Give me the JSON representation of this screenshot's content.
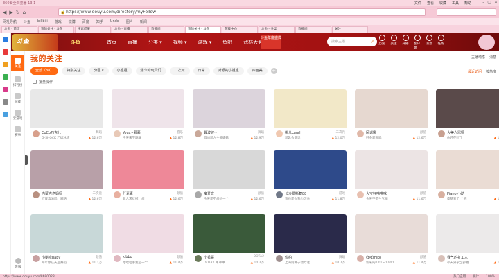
{
  "browser": {
    "title": "360安全浏览器 13.1",
    "menus": [
      "文件",
      "查看",
      "收藏",
      "工具",
      "帮助"
    ],
    "url_scheme": "https://",
    "url": "www.douyu.com/directory/myFollow",
    "bookmarks": [
      "网址导航",
      "斗鱼",
      "bilibili",
      "游戏",
      "微博",
      "百度",
      "知乎",
      "Undo",
      "图片",
      "新闻"
    ],
    "tabs": [
      "斗鱼 - 首页",
      "我的关注 - 斗鱼",
      "搜索结果",
      "斗鱼 - 直播",
      "直播间",
      "我的关注 - 斗鱼",
      "游戏中心",
      "斗鱼 - 分类",
      "直播间",
      "关注"
    ],
    "active_tab": 5,
    "status_url": "https://www.douyu.com/8690028",
    "status_right": [
      "热门应用",
      "统计",
      "100%"
    ]
  },
  "site": {
    "logo_text": "斗鱼",
    "logo_sub": "斗鱼",
    "nav": [
      "首页",
      "直播",
      "分类 ▾",
      "视频 ▾",
      "游戏 ▾",
      "鱼吧",
      "武林大会"
    ],
    "promo": "斗鱼年度盛典",
    "search_placeholder": "搜索主播",
    "header_icons": [
      "历史",
      "关注",
      "开播",
      "客户端",
      "消息",
      "任务"
    ],
    "sidebar": [
      {
        "label": "关注",
        "active": true,
        "color": "#ff6a13"
      },
      {
        "label": "排行榜",
        "active": false,
        "color": "#c9c9c9"
      },
      {
        "label": "游戏",
        "active": false,
        "color": "#c9c9c9"
      },
      {
        "label": "云游戏",
        "active": false,
        "color": "#c9c9c9"
      },
      {
        "label": "赛事",
        "active": false,
        "color": "#c9c9c9"
      }
    ],
    "sidebar_bottom": "客服"
  },
  "main": {
    "title": "我的关注",
    "right_options": [
      "主播动态",
      "消息"
    ],
    "filters": [
      "全部（88）",
      "特别关注",
      "分区 ▾",
      "小姐姐",
      "爆少的玩具们",
      "二次元",
      "日常",
      "对眼的小姐姐",
      "四画美"
    ],
    "active_filter": 0,
    "sort_options": [
      "最近访问",
      "按热度"
    ],
    "batch_label": "批量操作"
  },
  "cards": [
    {
      "name": "CoCo巧克儿",
      "sub": "G-SHOCK 乙级冰冻",
      "cat": "舞蹈",
      "heat": "12.6万",
      "thumb": "#e8e8e8",
      "ava": "#d8a08c"
    },
    {
      "name": "Youx~慕慕",
      "sub": "今天来学跳舞",
      "cat": "音乐",
      "heat": "12.8万",
      "thumb": "#efe4ea",
      "ava": "#e8c9b7"
    },
    {
      "name": "翼波波~",
      "sub": "四川新人主播蟾蜍",
      "cat": "舞蹈",
      "heat": "12.9万",
      "thumb": "#dcd4dc",
      "ava": "#c9a899"
    },
    {
      "name": "桃儿Laurl",
      "sub": "新歌会说话",
      "cat": "二次元",
      "heat": "12.0万",
      "thumb": "#f2e8c8",
      "ava": "#f0c8b0"
    },
    {
      "name": "民谣娜",
      "sub": "好多新歌唱",
      "cat": "颜值",
      "heat": "12.6万",
      "thumb": "#e6d8d0",
      "ava": "#e0b8a8"
    },
    {
      "name": "大美人罂姬",
      "sub": "你还在吗了",
      "cat": "颜值",
      "heat": "12.6万",
      "thumb": "#5a4a4a",
      "ava": "#c8a090"
    },
    {
      "name": "内蒙古老妈妈",
      "sub": "红双喜清唱，哪路",
      "cat": "二次元",
      "heat": "12.6万",
      "thumb": "#b8a0a8",
      "ava": "#b89080"
    },
    {
      "name": "阡素素",
      "sub": "新人求抚摸，想上",
      "cat": "颜值",
      "heat": "12.6万",
      "thumb": "#ee8898",
      "ava": "#e8b0a0"
    },
    {
      "name": "魔爱玫",
      "sub": "今天是不想想一个",
      "cat": "颜值",
      "heat": "12.6万",
      "thumb": "#d8d8d8",
      "ava": "#a8a8a8"
    },
    {
      "name": "长沙爱撕藏88",
      "sub": "我也是你我也可季",
      "cat": "游戏",
      "heat": "11.8万",
      "thumb": "#2e4a8a",
      "ava": "#707888"
    },
    {
      "name": "大宝好喵喵咪",
      "sub": "今天不是生气潮",
      "cat": "颜值",
      "heat": "11.6万",
      "thumb": "#ece4e4",
      "ava": "#e8c0b0"
    },
    {
      "name": "Pianoi小助",
      "sub": "电脑对了 个吧",
      "cat": "颜值",
      "heat": "12.0万",
      "thumb": "#eadcd4",
      "ava": "#d8b0a0"
    },
    {
      "name": "小秘密baby",
      "sub": "每年你在天后舞蹈",
      "cat": "颜值",
      "heat": "11.1万",
      "thumb": "#c8d8d8",
      "ava": "#c8a0a0"
    },
    {
      "name": "kibbo",
      "sub": "哈哈喵手我是一个",
      "cat": "颜值",
      "heat": "11.4万",
      "thumb": "#f0dce4",
      "ava": "#e0b8c0"
    },
    {
      "name": "小秀哥",
      "sub": "DOTA2 冲冲冲",
      "cat": "DOTA2",
      "heat": "10.2万",
      "thumb": "#3a5a3a",
      "ava": "#6a7a5a"
    },
    {
      "name": "优柏",
      "sub": "上海阿狮子动力话",
      "cat": "舞蹈",
      "heat": "10.7万",
      "thumb": "#2a2a4a",
      "ava": "#a09090"
    },
    {
      "name": "咩咩miko",
      "sub": "新来的0.01~0.000",
      "cat": "颜值",
      "heat": "11.4万",
      "thumb": "#e8dcd8",
      "ava": "#d8b0a8"
    },
    {
      "name": "我气的打工人",
      "sub": "小天分子全部喔",
      "cat": "颜值",
      "heat": "12.6万",
      "thumb": "#eceaea",
      "ava": "#d8c0b8"
    }
  ]
}
